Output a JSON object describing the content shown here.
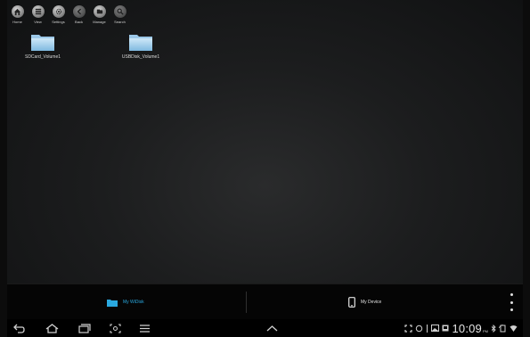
{
  "toolbar": {
    "items": [
      {
        "label": "Home",
        "icon": "home-icon"
      },
      {
        "label": "View",
        "icon": "view-icon"
      },
      {
        "label": "Settings",
        "icon": "gear-icon"
      },
      {
        "label": "Back",
        "icon": "back-icon"
      },
      {
        "label": "Manage",
        "icon": "manage-icon"
      },
      {
        "label": "Search",
        "icon": "search-icon"
      }
    ]
  },
  "folders": [
    {
      "name": "SDCard_Volume1",
      "icon": "folder-icon"
    },
    {
      "name": "USBDisk_Volume1",
      "icon": "folder-icon"
    }
  ],
  "actionbar": {
    "wifidisk_label": "My WiDisk",
    "device_label": "My Device",
    "accent_color": "#2aa9e0"
  },
  "status": {
    "time": "10:09",
    "ampm": "PM"
  }
}
